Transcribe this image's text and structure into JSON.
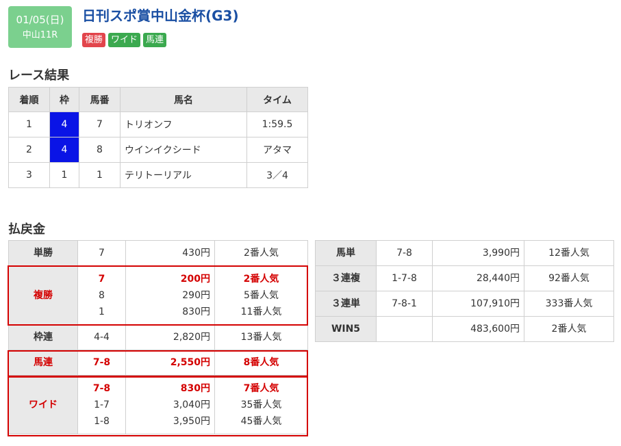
{
  "header": {
    "date": "01/05(日)",
    "venue_race": "中山11R",
    "race_name": "日刊スポ賞中山金杯(G3)",
    "tags": [
      {
        "label": "複勝",
        "color": "#e2454c"
      },
      {
        "label": "ワイド",
        "color": "#3ba94f"
      },
      {
        "label": "馬連",
        "color": "#3ba94f"
      }
    ]
  },
  "results": {
    "heading": "レース結果",
    "columns": [
      "着順",
      "枠",
      "馬番",
      "馬名",
      "タイム"
    ],
    "rows": [
      {
        "rank": "1",
        "waku": "4",
        "umaban": "7",
        "name": "トリオンフ",
        "time": "1:59.5"
      },
      {
        "rank": "2",
        "waku": "4",
        "umaban": "8",
        "name": "ウインイクシード",
        "time": "アタマ"
      },
      {
        "rank": "3",
        "waku": "1",
        "umaban": "1",
        "name": "テリトーリアル",
        "time": "3／4"
      }
    ]
  },
  "payout": {
    "heading": "払戻金",
    "left": [
      {
        "type": "単勝",
        "entries": [
          {
            "combo": "7",
            "amount": "430円",
            "pop": "2番人気",
            "hit": false
          }
        ]
      },
      {
        "type": "複勝",
        "entries": [
          {
            "combo": "7",
            "amount": "200円",
            "pop": "2番人気",
            "hit": true
          },
          {
            "combo": "8",
            "amount": "290円",
            "pop": "5番人気",
            "hit": false
          },
          {
            "combo": "1",
            "amount": "830円",
            "pop": "11番人気",
            "hit": false
          }
        ]
      },
      {
        "type": "枠連",
        "entries": [
          {
            "combo": "4-4",
            "amount": "2,820円",
            "pop": "13番人気",
            "hit": false
          }
        ]
      },
      {
        "type": "馬連",
        "entries": [
          {
            "combo": "7-8",
            "amount": "2,550円",
            "pop": "8番人気",
            "hit": true
          }
        ]
      },
      {
        "type": "ワイド",
        "entries": [
          {
            "combo": "7-8",
            "amount": "830円",
            "pop": "7番人気",
            "hit": true
          },
          {
            "combo": "1-7",
            "amount": "3,040円",
            "pop": "35番人気",
            "hit": false
          },
          {
            "combo": "1-8",
            "amount": "3,950円",
            "pop": "45番人気",
            "hit": false
          }
        ]
      }
    ],
    "right": [
      {
        "type": "馬単",
        "combo": "7-8",
        "amount": "3,990円",
        "pop": "12番人気"
      },
      {
        "type": "３連複",
        "combo": "1-7-8",
        "amount": "28,440円",
        "pop": "92番人気"
      },
      {
        "type": "３連単",
        "combo": "7-8-1",
        "amount": "107,910円",
        "pop": "333番人気"
      },
      {
        "type": "WIN5",
        "combo": "",
        "amount": "483,600円",
        "pop": "2番人気"
      }
    ]
  }
}
